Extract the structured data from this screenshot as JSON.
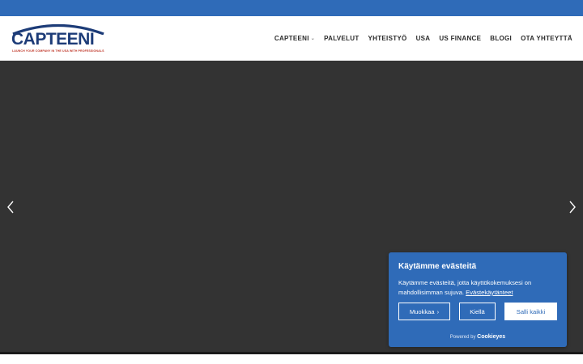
{
  "header": {
    "logo": {
      "word": "CAPTEENI",
      "tagline": "LAUNCH YOUR COMPANY IN THE USA WITH PROFESSIONALS"
    },
    "nav": [
      {
        "label": "CAPTEENI",
        "has_submenu": true
      },
      {
        "label": "PALVELUT"
      },
      {
        "label": "YHTEISTYÖ"
      },
      {
        "label": "USA"
      },
      {
        "label": "US FINANCE"
      },
      {
        "label": "BLOGI"
      },
      {
        "label": "OTA YHTEYTTÄ"
      }
    ]
  },
  "slider": {
    "prev_icon": "chevron-left-icon",
    "next_icon": "chevron-right-icon"
  },
  "cookie_banner": {
    "title": "Käytämme evästeitä",
    "body": "Käytämme evästeitä, jotta käyttökokemuksesi on mahdollisimman sujuva.",
    "policy_link": "Evästekäytänteet",
    "customize_label": "Muokkaa",
    "reject_label": "Kiellä",
    "accept_label": "Salli kaikki",
    "powered_prefix": "Powered by",
    "powered_brand": "Cookieyes"
  },
  "colors": {
    "brand_blue": "#2f6bb8",
    "logo_navy": "#1d3c78",
    "hero_bg": "#333333"
  }
}
